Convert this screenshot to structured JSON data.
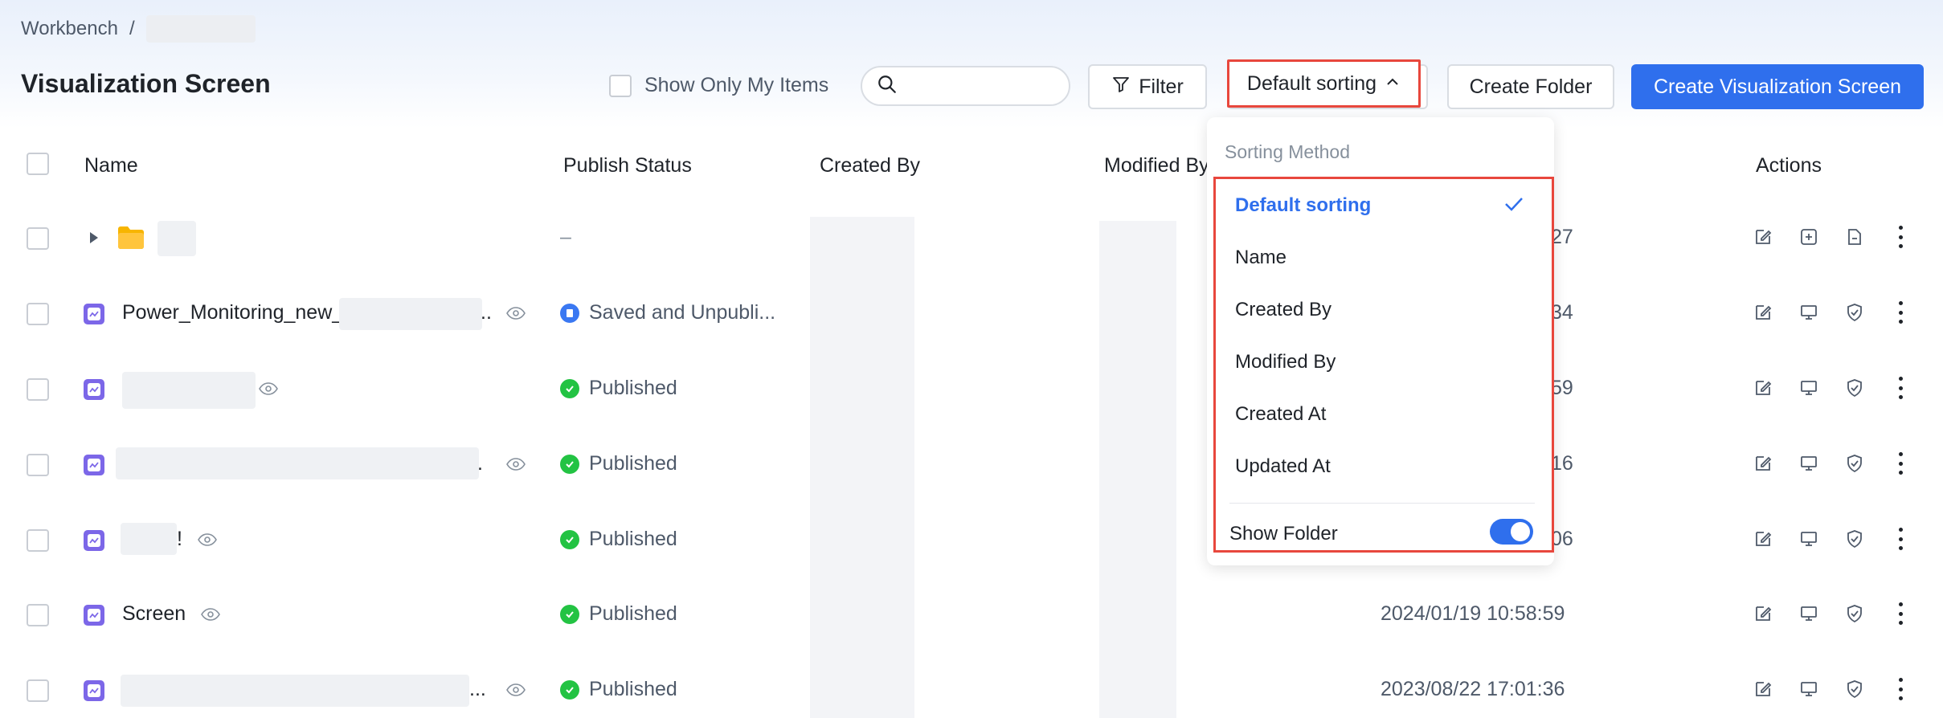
{
  "breadcrumb": {
    "root": "Workbench",
    "separator": "/"
  },
  "page_title": "Visualization Screen",
  "toolbar": {
    "show_only_mine_label": "Show Only My Items",
    "search_placeholder": "",
    "filter_label": "Filter",
    "sort_label": "Default sorting",
    "create_folder_label": "Create Folder",
    "create_screen_label": "Create Visualization Screen"
  },
  "table": {
    "headers": {
      "name": "Name",
      "publish_status": "Publish Status",
      "created_by": "Created By",
      "modified_by": "Modified By",
      "actions": "Actions"
    },
    "rows": [
      {
        "type": "folder",
        "name": "",
        "status": "–",
        "date_suffix": "27"
      },
      {
        "type": "screen",
        "name": "Power_Monitoring_new_",
        "name_tail": "..",
        "status": "Saved and Unpubli...",
        "date_suffix": "34"
      },
      {
        "type": "screen",
        "name": "",
        "status": "Published",
        "date_suffix": "59"
      },
      {
        "type": "screen",
        "name": "",
        "name_tail": ".",
        "status": "Published",
        "date_suffix": "16"
      },
      {
        "type": "screen",
        "name": "",
        "name_tail": "!",
        "status": "Published",
        "date_suffix": "06"
      },
      {
        "type": "screen",
        "name": "Screen",
        "status": "Published",
        "date": "2024/01/19 10:58:59"
      },
      {
        "type": "screen",
        "name": "",
        "name_tail": "...",
        "status": "Published",
        "date": "2023/08/22 17:01:36"
      }
    ]
  },
  "sort_dropdown": {
    "heading": "Sorting Method",
    "options": [
      "Default sorting",
      "Name",
      "Created By",
      "Modified By",
      "Created At",
      "Updated At"
    ],
    "selected": "Default sorting",
    "show_folder_label": "Show Folder",
    "show_folder_on": true
  },
  "colors": {
    "primary": "#2f6fed",
    "success": "#23c343",
    "highlight_border": "#e8473d",
    "screen_icon": "#7c67e8",
    "folder_icon": "#f7b500"
  }
}
